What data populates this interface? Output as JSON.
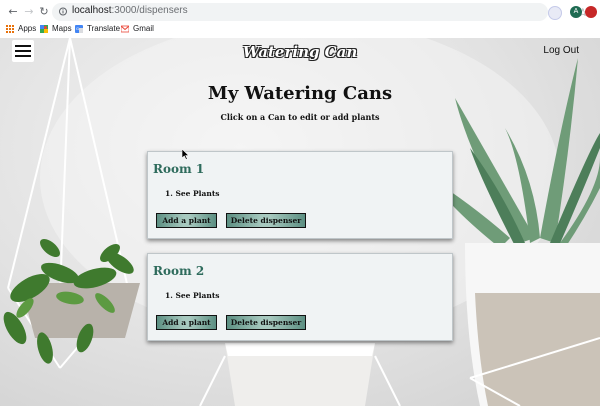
{
  "browser": {
    "url_host": "localhost",
    "url_path": ":3000/dispensers",
    "extension_avatar": "A",
    "bookmarks": [
      {
        "label": "Apps",
        "icon": "apps-grid-icon"
      },
      {
        "label": "Maps",
        "icon": "maps-icon"
      },
      {
        "label": "Translate",
        "icon": "translate-icon"
      },
      {
        "label": "Gmail",
        "icon": "gmail-icon"
      }
    ]
  },
  "app": {
    "brand": "Watering Can",
    "logout_label": "Log Out",
    "heading": "My Watering Cans",
    "subheading": "Click on a Can to edit or add plants"
  },
  "dispensers": [
    {
      "name": "Room 1",
      "list_item": "1. See Plants",
      "add_label": "Add a plant",
      "delete_label": "Delete dispenser"
    },
    {
      "name": "Room 2",
      "list_item": "1. See Plants",
      "add_label": "Add a plant",
      "delete_label": "Delete dispenser"
    }
  ],
  "colors": {
    "card_title": "#2e6b5c",
    "button_gradient_edge": "#5c8f82",
    "button_gradient_center": "#a7c9bf"
  }
}
